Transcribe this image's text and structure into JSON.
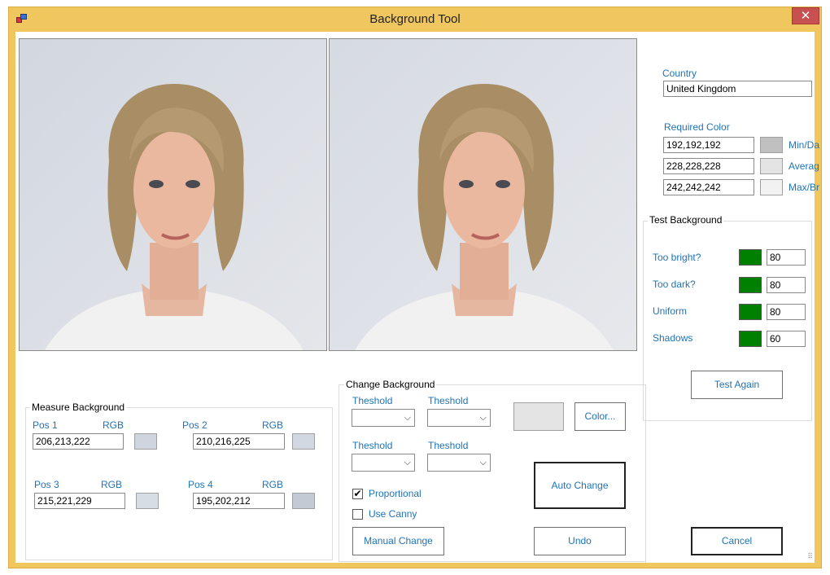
{
  "window": {
    "title": "Background Tool",
    "close_label": "✕"
  },
  "icons": {
    "app": "app-icon",
    "close": "close-icon",
    "combo": "chevron-down-icon",
    "check": "check-icon"
  },
  "country": {
    "label": "Country",
    "value": "United Kingdom"
  },
  "required_color": {
    "label": "Required Color",
    "rows": [
      {
        "value": "192,192,192",
        "label": "Min/Da",
        "color": "#c0c0c0"
      },
      {
        "value": "228,228,228",
        "label": "Averag",
        "color": "#e4e4e4"
      },
      {
        "value": "242,242,242",
        "label": "Max/Br",
        "color": "#f2f2f2"
      }
    ]
  },
  "test_background": {
    "title": "Test Background",
    "rows": [
      {
        "label": "Too bright?",
        "value": "80",
        "color": "#008000"
      },
      {
        "label": "Too dark?",
        "value": "80",
        "color": "#008000"
      },
      {
        "label": "Uniform",
        "value": "80",
        "color": "#008000"
      },
      {
        "label": "Shadows",
        "value": "60",
        "color": "#008000"
      }
    ],
    "test_again_label": "Test Again"
  },
  "measure_background": {
    "title": "Measure Background",
    "positions": [
      {
        "label": "Pos 1",
        "rgb_label": "RGB",
        "value": "206,213,222",
        "color": "#ced5de"
      },
      {
        "label": "Pos 2",
        "rgb_label": "RGB",
        "value": "210,216,225",
        "color": "#d2d8e1"
      },
      {
        "label": "Pos 3",
        "rgb_label": "RGB",
        "value": "215,221,229",
        "color": "#d7dde5"
      },
      {
        "label": "Pos 4",
        "rgb_label": "RGB",
        "value": "195,202,212",
        "color": "#c3cad4"
      }
    ]
  },
  "change_background": {
    "title": "Change Background",
    "threshold_labels": [
      "Theshold",
      "Theshold",
      "Theshold",
      "Theshold"
    ],
    "color_swatch": "#e4e4e4",
    "color_button_label": "Color...",
    "auto_change_label": "Auto Change",
    "proportional": {
      "label": "Proportional",
      "checked": true,
      "mark": "✔"
    },
    "use_canny": {
      "label": "Use Canny",
      "checked": false
    },
    "manual_change_label": "Manual Change",
    "undo_label": "Undo"
  },
  "cancel_label": "Cancel",
  "grip_glyph": "⠿"
}
